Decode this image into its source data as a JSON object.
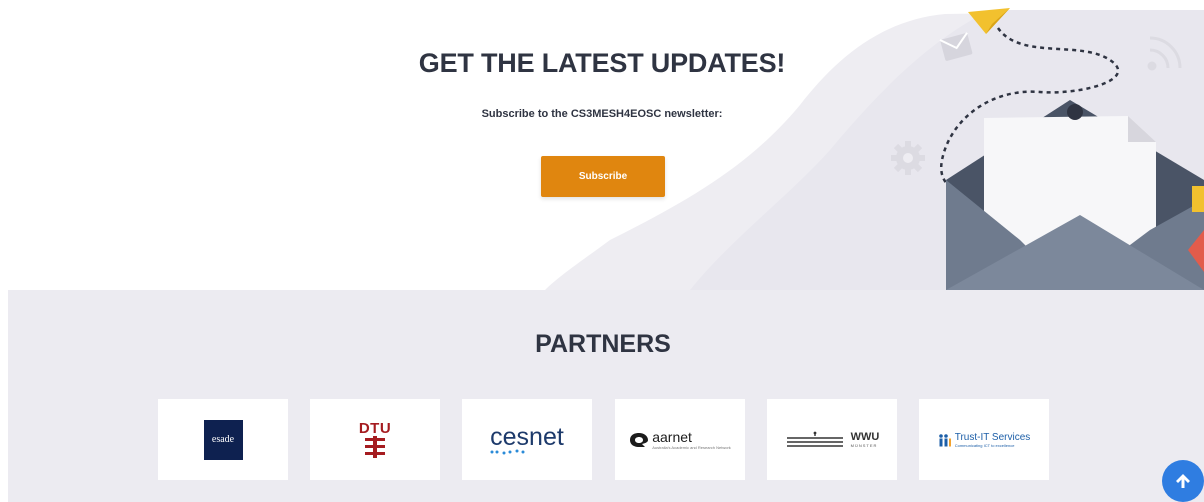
{
  "newsletter": {
    "title": "GET THE LATEST UPDATES!",
    "subtitle": "Subscribe to the CS3MESH4EOSC newsletter:",
    "subscribe_label": "Subscribe",
    "illustration_icon": "envelope-illustration"
  },
  "partners": {
    "title": "PARTNERS",
    "logos": [
      {
        "name": "esade",
        "text": "esade"
      },
      {
        "name": "dtu",
        "text": "DTU"
      },
      {
        "name": "cesnet",
        "text": "cesnet"
      },
      {
        "name": "aarnet",
        "text": "aarnet",
        "subtext": "Australia's Academic and Research Network"
      },
      {
        "name": "wwu",
        "text": "WWU",
        "subtext": "MÜNSTER"
      },
      {
        "name": "trust-it",
        "text": "Trust-IT Services",
        "subtext": "Communicating ICT to excellence"
      }
    ]
  },
  "scroll_top": {
    "icon": "arrow-up-icon"
  },
  "colors": {
    "accent": "#e0860f",
    "heading": "#2f3442",
    "band": "#ecebf1",
    "scroll_button": "#2f7de1"
  }
}
